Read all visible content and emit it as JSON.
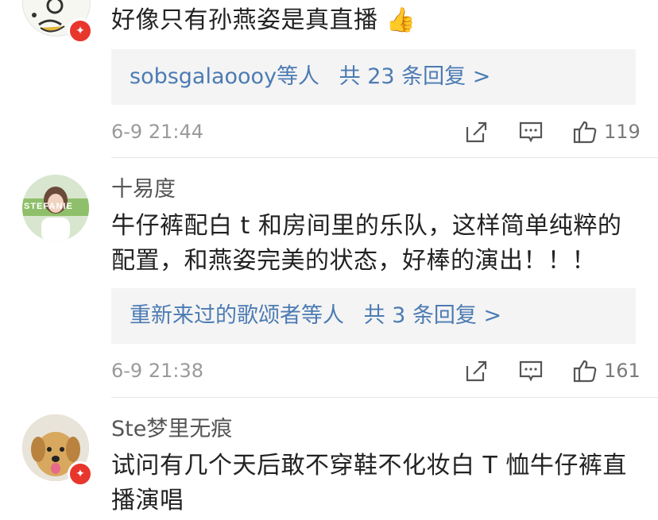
{
  "comments": [
    {
      "text": "好像只有孙燕姿是真直播",
      "emoji": "👍",
      "reply_users": "sobsgalaoooy",
      "reply_suffix": "等人",
      "reply_count": "共 23 条回复 >",
      "time": "6-9 21:44",
      "likes": "119",
      "badge_icon": "weibo-user-badge"
    },
    {
      "username": "十易度",
      "text": "牛仔裤配白 t 和房间里的乐队，这样简单纯粹的配置，和燕姿完美的状态，好棒的演出！！！",
      "reply_users": "重新来过的歌颂者",
      "reply_suffix": "等人",
      "reply_count": "共 3 条回复 >",
      "time": "6-9 21:38",
      "likes": "161",
      "avatar_text": "STEFANIE"
    },
    {
      "username": "Ste梦里无痕",
      "text": "试问有几个天后敢不穿鞋不化妆白 T 恤牛仔裤直播演唱",
      "badge_icon": "weibo-user-badge"
    }
  ],
  "colors": {
    "link": "#4c7bb3",
    "badge": "#e8362d",
    "reply_bg": "#f4f4f4",
    "meta": "#9a9a9a"
  }
}
